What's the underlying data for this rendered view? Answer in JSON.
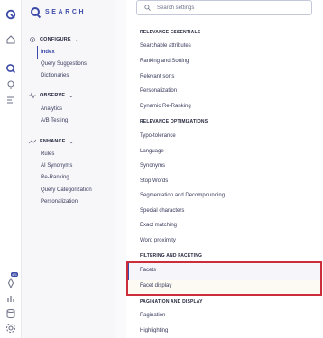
{
  "brand": {
    "name": "SEARCH"
  },
  "rail": {
    "icons": [
      "home-icon",
      "search-icon",
      "bulb-icon",
      "list-icon",
      "rocket-icon",
      "chart-icon",
      "database-icon",
      "settings-icon"
    ],
    "badge": "4/5"
  },
  "nav": {
    "configure": {
      "label": "CONFIGURE",
      "items": [
        "Index",
        "Query Suggestions",
        "Dictionaries"
      ]
    },
    "observe": {
      "label": "OBSERVE",
      "items": [
        "Analytics",
        "A/B Testing"
      ]
    },
    "enhance": {
      "label": "ENHANCE",
      "items": [
        "Rules",
        "AI Synonyms",
        "Re-Ranking",
        "Query Categorization",
        "Personalization"
      ]
    }
  },
  "search": {
    "placeholder": "Search settings"
  },
  "settings": {
    "relevance_essentials": {
      "title": "RELEVANCE ESSENTIALS",
      "items": [
        "Searchable attributes",
        "Ranking and Sorting",
        "Relevant sorts",
        "Personalization",
        "Dynamic Re-Ranking"
      ]
    },
    "relevance_optimizations": {
      "title": "RELEVANCE OPTIMIZATIONS",
      "items": [
        "Typo-tolerance",
        "Language",
        "Synonyms",
        "Stop Words",
        "Segmentation and Decompounding",
        "Special characters",
        "Exact matching",
        "Word proximity"
      ]
    },
    "filtering_faceting": {
      "title": "FILTERING AND FACETING",
      "items": [
        "Facets",
        "Facet display"
      ]
    },
    "pagination_display": {
      "title": "PAGINATION AND DISPLAY",
      "items": [
        "Pagination",
        "Highlighting"
      ]
    }
  },
  "colors": {
    "accent": "#3b4aa8",
    "highlight_border": "#cc2d3b"
  }
}
